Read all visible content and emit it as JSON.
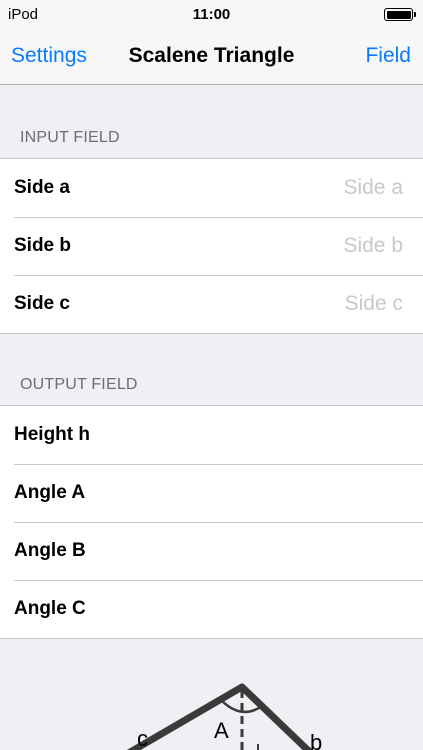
{
  "status_bar": {
    "carrier": "iPod",
    "time": "11:00"
  },
  "nav": {
    "left_button": "Settings",
    "title": "Scalene Triangle",
    "right_button": "Field"
  },
  "input_section": {
    "header": "INPUT FIELD",
    "rows": [
      {
        "label": "Side a",
        "placeholder": "Side a"
      },
      {
        "label": "Side b",
        "placeholder": "Side b"
      },
      {
        "label": "Side c",
        "placeholder": "Side c"
      }
    ]
  },
  "output_section": {
    "header": "OUTPUT FIELD",
    "rows": [
      {
        "label": "Height h"
      },
      {
        "label": "Angle A"
      },
      {
        "label": "Angle B"
      },
      {
        "label": "Angle C"
      }
    ]
  },
  "diagram": {
    "labels": {
      "side_c": "c",
      "angle_A": "A",
      "side_b": "b"
    }
  },
  "colors": {
    "accent": "#0a7aff",
    "background": "#efeff4",
    "separator": "#c8c7cc",
    "placeholder": "#c7c7cd",
    "section_header": "#6d6d72"
  }
}
